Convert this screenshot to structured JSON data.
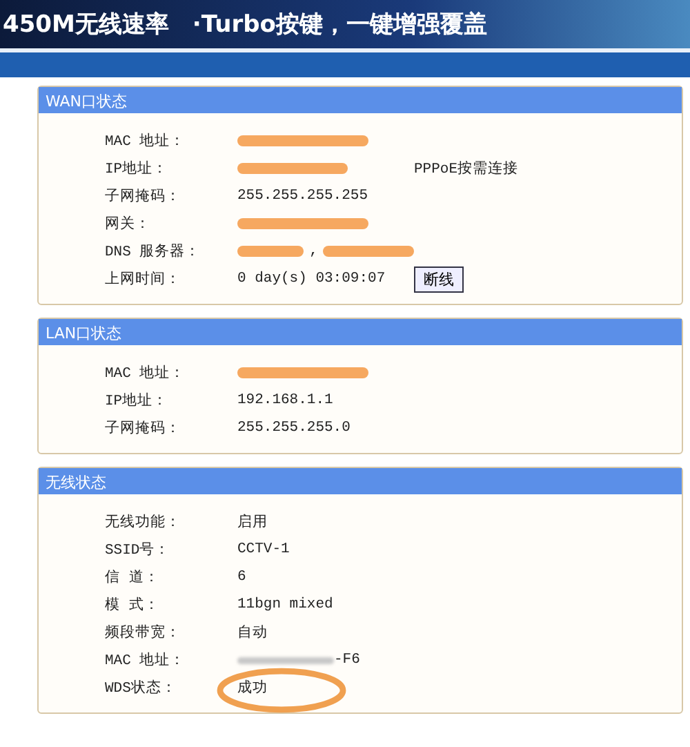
{
  "banner": {
    "title": "450M无线速率　·Turbo按键，一键增强覆盖"
  },
  "panels": [
    {
      "title": "WAN口状态",
      "rows": [
        {
          "label": "MAC 地址：",
          "cells": [
            {
              "kind": "redacted"
            }
          ]
        },
        {
          "label": "IP地址：",
          "cells": [
            {
              "kind": "redacted"
            },
            {
              "kind": "text",
              "text": "PPPoE按需连接"
            }
          ]
        },
        {
          "label": "子网掩码：",
          "cells": [
            {
              "kind": "text",
              "text": "255.255.255.255"
            }
          ]
        },
        {
          "label": "网关：",
          "cells": [
            {
              "kind": "redacted"
            }
          ]
        },
        {
          "label": "DNS 服务器：",
          "cells": [
            {
              "kind": "redacted_pair",
              "text": ","
            }
          ]
        },
        {
          "label": "上网时间：",
          "cells": [
            {
              "kind": "text",
              "text": "0 day(s) 03:09:07"
            },
            {
              "kind": "button",
              "text": "断线"
            }
          ]
        }
      ]
    },
    {
      "title": "LAN口状态",
      "rows": [
        {
          "label": "MAC 地址：",
          "cells": [
            {
              "kind": "redacted"
            }
          ]
        },
        {
          "label": "IP地址：",
          "cells": [
            {
              "kind": "text",
              "text": "192.168.1.1"
            }
          ]
        },
        {
          "label": "子网掩码：",
          "cells": [
            {
              "kind": "text",
              "text": "255.255.255.0"
            }
          ]
        }
      ]
    },
    {
      "title": "无线状态",
      "rows": [
        {
          "label": "无线功能：",
          "cells": [
            {
              "kind": "text",
              "text": "启用"
            }
          ]
        },
        {
          "label": "SSID号：",
          "cells": [
            {
              "kind": "text",
              "text": "CCTV-1"
            }
          ]
        },
        {
          "label": "信 道：",
          "cells": [
            {
              "kind": "text",
              "text": "6"
            }
          ]
        },
        {
          "label": "模 式：",
          "cells": [
            {
              "kind": "text",
              "text": "11bgn mixed"
            }
          ]
        },
        {
          "label": "频段带宽：",
          "cells": [
            {
              "kind": "text",
              "text": "自动"
            }
          ]
        },
        {
          "label": "MAC 地址：",
          "cells": [
            {
              "kind": "blurred",
              "text": "-F6"
            }
          ]
        },
        {
          "label": "WDS状态：",
          "cells": [
            {
              "kind": "text",
              "text": "成功",
              "circled": true
            }
          ]
        }
      ]
    }
  ]
}
